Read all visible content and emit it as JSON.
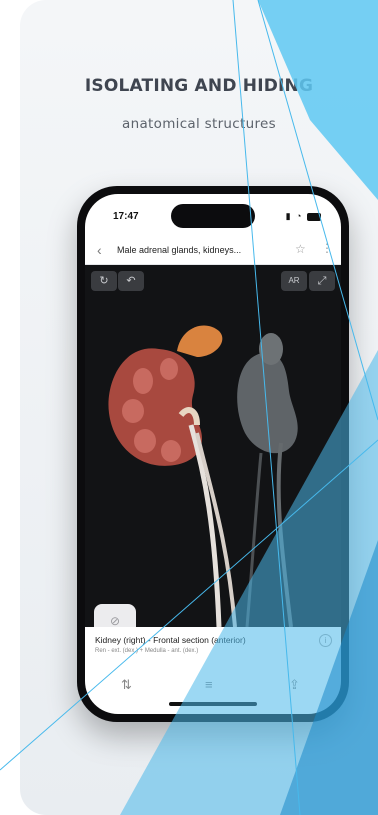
{
  "headline": "ISOLATING AND HIDING",
  "subheadline": "anatomical structures",
  "phone": {
    "status_time": "17:47",
    "nav_title": "Male adrenal glands, kidneys...",
    "toolbar": {
      "reset_label": "↻",
      "undo_label": "↶",
      "ar_label": "AR",
      "fullscreen_label": "⤢"
    },
    "structure": {
      "name": "Kidney (right) - Frontal section (anterior)",
      "path": "Ren - ext. (dex.) + Medulla - ant. (dex.)"
    }
  },
  "colors": {
    "accent_light": "#5ec8f2",
    "accent_dark": "#1a88c8",
    "kidney": "#a8493f",
    "adrenal": "#d9833f"
  }
}
